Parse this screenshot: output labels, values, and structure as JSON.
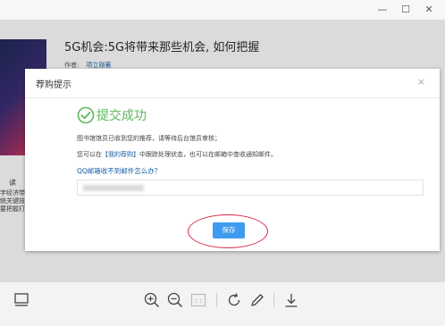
{
  "background_page": {
    "headline": "5G机会:5G将带来那些机会, 如何把握",
    "byline_label": "作者:",
    "byline_author": "项立刚著",
    "side_tab": "读",
    "side_text": "字经济带统关键技要把握打"
  },
  "dialog": {
    "title": "荐购提示",
    "close_glyph": "×",
    "success_text": "提交成功",
    "message_1": "图书馆馆员已收到您的推荐，请等待后台馆员审核；",
    "message_2_pre": "您可以在",
    "message_2_link": "【我的荐购】",
    "message_2_post": "中跟踪处理状态，也可以在邮箱中查收通知邮件。",
    "email_question": "QQ邮箱收不到邮件怎么办？",
    "email_value_obscured": true,
    "save_label": "保存"
  },
  "window_controls": {
    "minimize": "—",
    "maximize": "☐",
    "close": "✕"
  },
  "toolbar": {
    "icons": [
      "thumbnail-icon",
      "zoom-in-icon",
      "zoom-out-icon",
      "actual-size-icon",
      "rotate-icon",
      "edit-icon",
      "download-icon"
    ],
    "actual_size_label": "1:1"
  },
  "colors": {
    "success_green": "#5cb85c",
    "link_blue": "#1a5fa8",
    "save_button": "#3e9bf0",
    "highlight_red": "#d92a4a"
  }
}
